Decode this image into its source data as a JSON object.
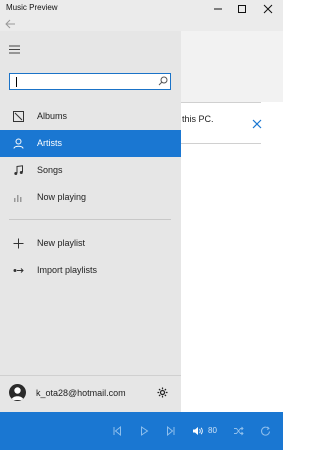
{
  "window": {
    "title": "Music Preview"
  },
  "search": {
    "placeholder": ""
  },
  "nav": {
    "items": [
      {
        "label": "Albums",
        "icon": "albums-icon",
        "active": false
      },
      {
        "label": "Artists",
        "icon": "artists-icon",
        "active": true
      },
      {
        "label": "Songs",
        "icon": "songs-icon",
        "active": false
      },
      {
        "label": "Now playing",
        "icon": "now-playing-icon",
        "active": false
      }
    ],
    "actions": [
      {
        "label": "New playlist",
        "icon": "plus-icon"
      },
      {
        "label": "Import playlists",
        "icon": "import-icon"
      }
    ]
  },
  "account": {
    "name": "k_ota28@hotmail.com"
  },
  "content": {
    "notice_text": "this PC."
  },
  "player": {
    "volume": "80"
  },
  "colors": {
    "accent": "#1a77d2",
    "nav_bg": "#e6e6e6",
    "titlebar_bg": "#ebebeb"
  }
}
